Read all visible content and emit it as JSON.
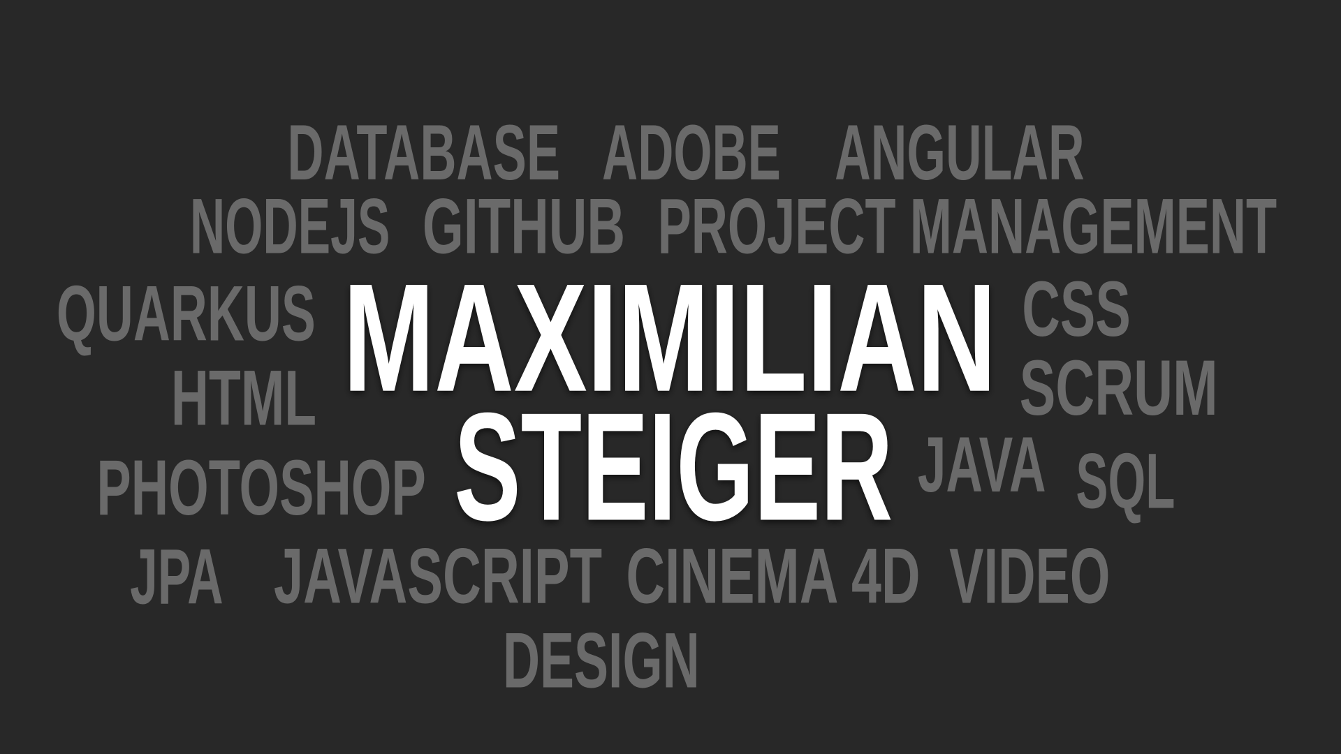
{
  "colors": {
    "background": "#282828",
    "keyword": "#6a6a6a",
    "name": "#ffffff"
  },
  "name": {
    "first": "MAXIMILIAN",
    "last": "STEIGER"
  },
  "keywords": [
    "DATABASE",
    "ADOBE",
    "ANGULAR",
    "NODEJS",
    "GITHUB",
    "PROJECT MANAGEMENT",
    "QUARKUS",
    "CSS",
    "HTML",
    "SCRUM",
    "JAVA",
    "SQL",
    "PHOTOSHOP",
    "JPA",
    "JAVASCRIPT",
    "CINEMA 4D",
    "VIDEO",
    "DESIGN"
  ]
}
